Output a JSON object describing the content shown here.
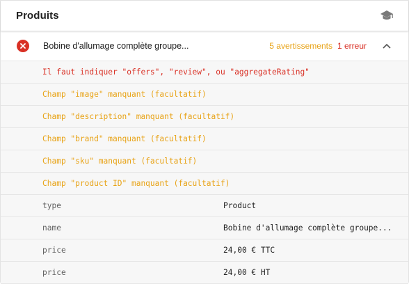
{
  "header": {
    "title": "Produits",
    "icon": "graduation-cap-icon"
  },
  "item": {
    "status_icon": "error-x-icon",
    "name": "Bobine d'allumage complète groupe...",
    "warnings": "5 avertissements",
    "errors": "1 erreur",
    "toggle_icon": "chevron-up-icon"
  },
  "messages": [
    {
      "type": "error",
      "text": "Il faut indiquer \"offers\", \"review\", ou \"aggregateRating\""
    },
    {
      "type": "warning",
      "text": "Champ \"image\" manquant (facultatif)"
    },
    {
      "type": "warning",
      "text": "Champ \"description\" manquant (facultatif)"
    },
    {
      "type": "warning",
      "text": "Champ \"brand\" manquant (facultatif)"
    },
    {
      "type": "warning",
      "text": "Champ \"sku\" manquant (facultatif)"
    },
    {
      "type": "warning",
      "text": "Champ \"product ID\" manquant (facultatif)"
    }
  ],
  "properties": [
    {
      "name": "type",
      "value": "Product"
    },
    {
      "name": "name",
      "value": "Bobine d'allumage complète groupe..."
    },
    {
      "name": "price",
      "value": "24,00 € TTC"
    },
    {
      "name": "price",
      "value": "24,00 € HT"
    }
  ],
  "colors": {
    "error": "#d93025",
    "warning": "#e8a317",
    "text": "#212121",
    "muted": "#616161"
  }
}
